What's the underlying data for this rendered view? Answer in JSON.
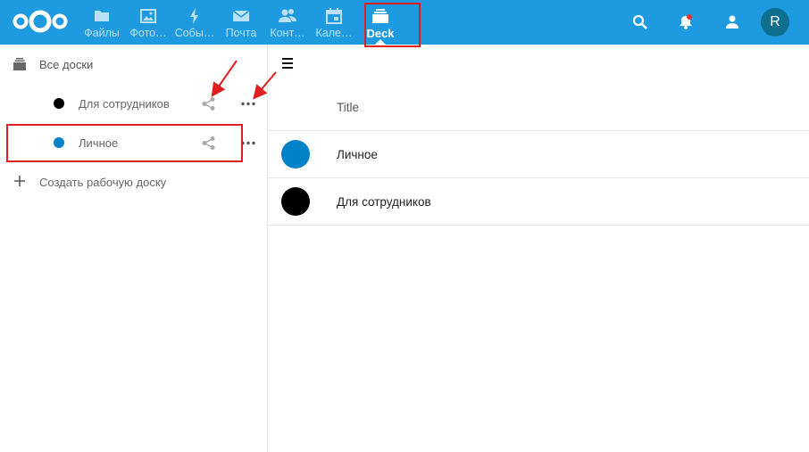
{
  "header": {
    "logo_icon": "nextcloud-logo-icon",
    "apps": [
      {
        "label": "Файлы",
        "icon": "folder-icon"
      },
      {
        "label": "Фото…",
        "icon": "image-icon"
      },
      {
        "label": "Собы…",
        "icon": "lightning-icon"
      },
      {
        "label": "Почта",
        "icon": "mail-icon"
      },
      {
        "label": "Конт…",
        "icon": "contacts-icon"
      },
      {
        "label": "Кале…",
        "icon": "calendar-icon"
      },
      {
        "label": "Deck",
        "icon": "deck-icon",
        "active": true
      }
    ],
    "search_icon": "search-icon",
    "notifications_icon": "bell-icon",
    "contacts_menu_icon": "contacts-menu-icon",
    "avatar_initial": "R"
  },
  "sidebar": {
    "all_boards": {
      "label": "Все доски",
      "icon": "archive-icon"
    },
    "boards": [
      {
        "label": "Для сотрудников",
        "color": "#000000"
      },
      {
        "label": "Личное",
        "color": "#0082c9"
      }
    ],
    "create_board": {
      "label": "Создать рабочую доску",
      "icon": "plus-icon"
    }
  },
  "main": {
    "column_title": "Title",
    "rows": [
      {
        "label": "Личное",
        "color": "#0082c9"
      },
      {
        "label": "Для сотрудников",
        "color": "#000000"
      }
    ]
  },
  "colors": {
    "header_bg": "#1e9ae0",
    "highlight": "#e02020",
    "notification_dot": "#e9322d"
  }
}
